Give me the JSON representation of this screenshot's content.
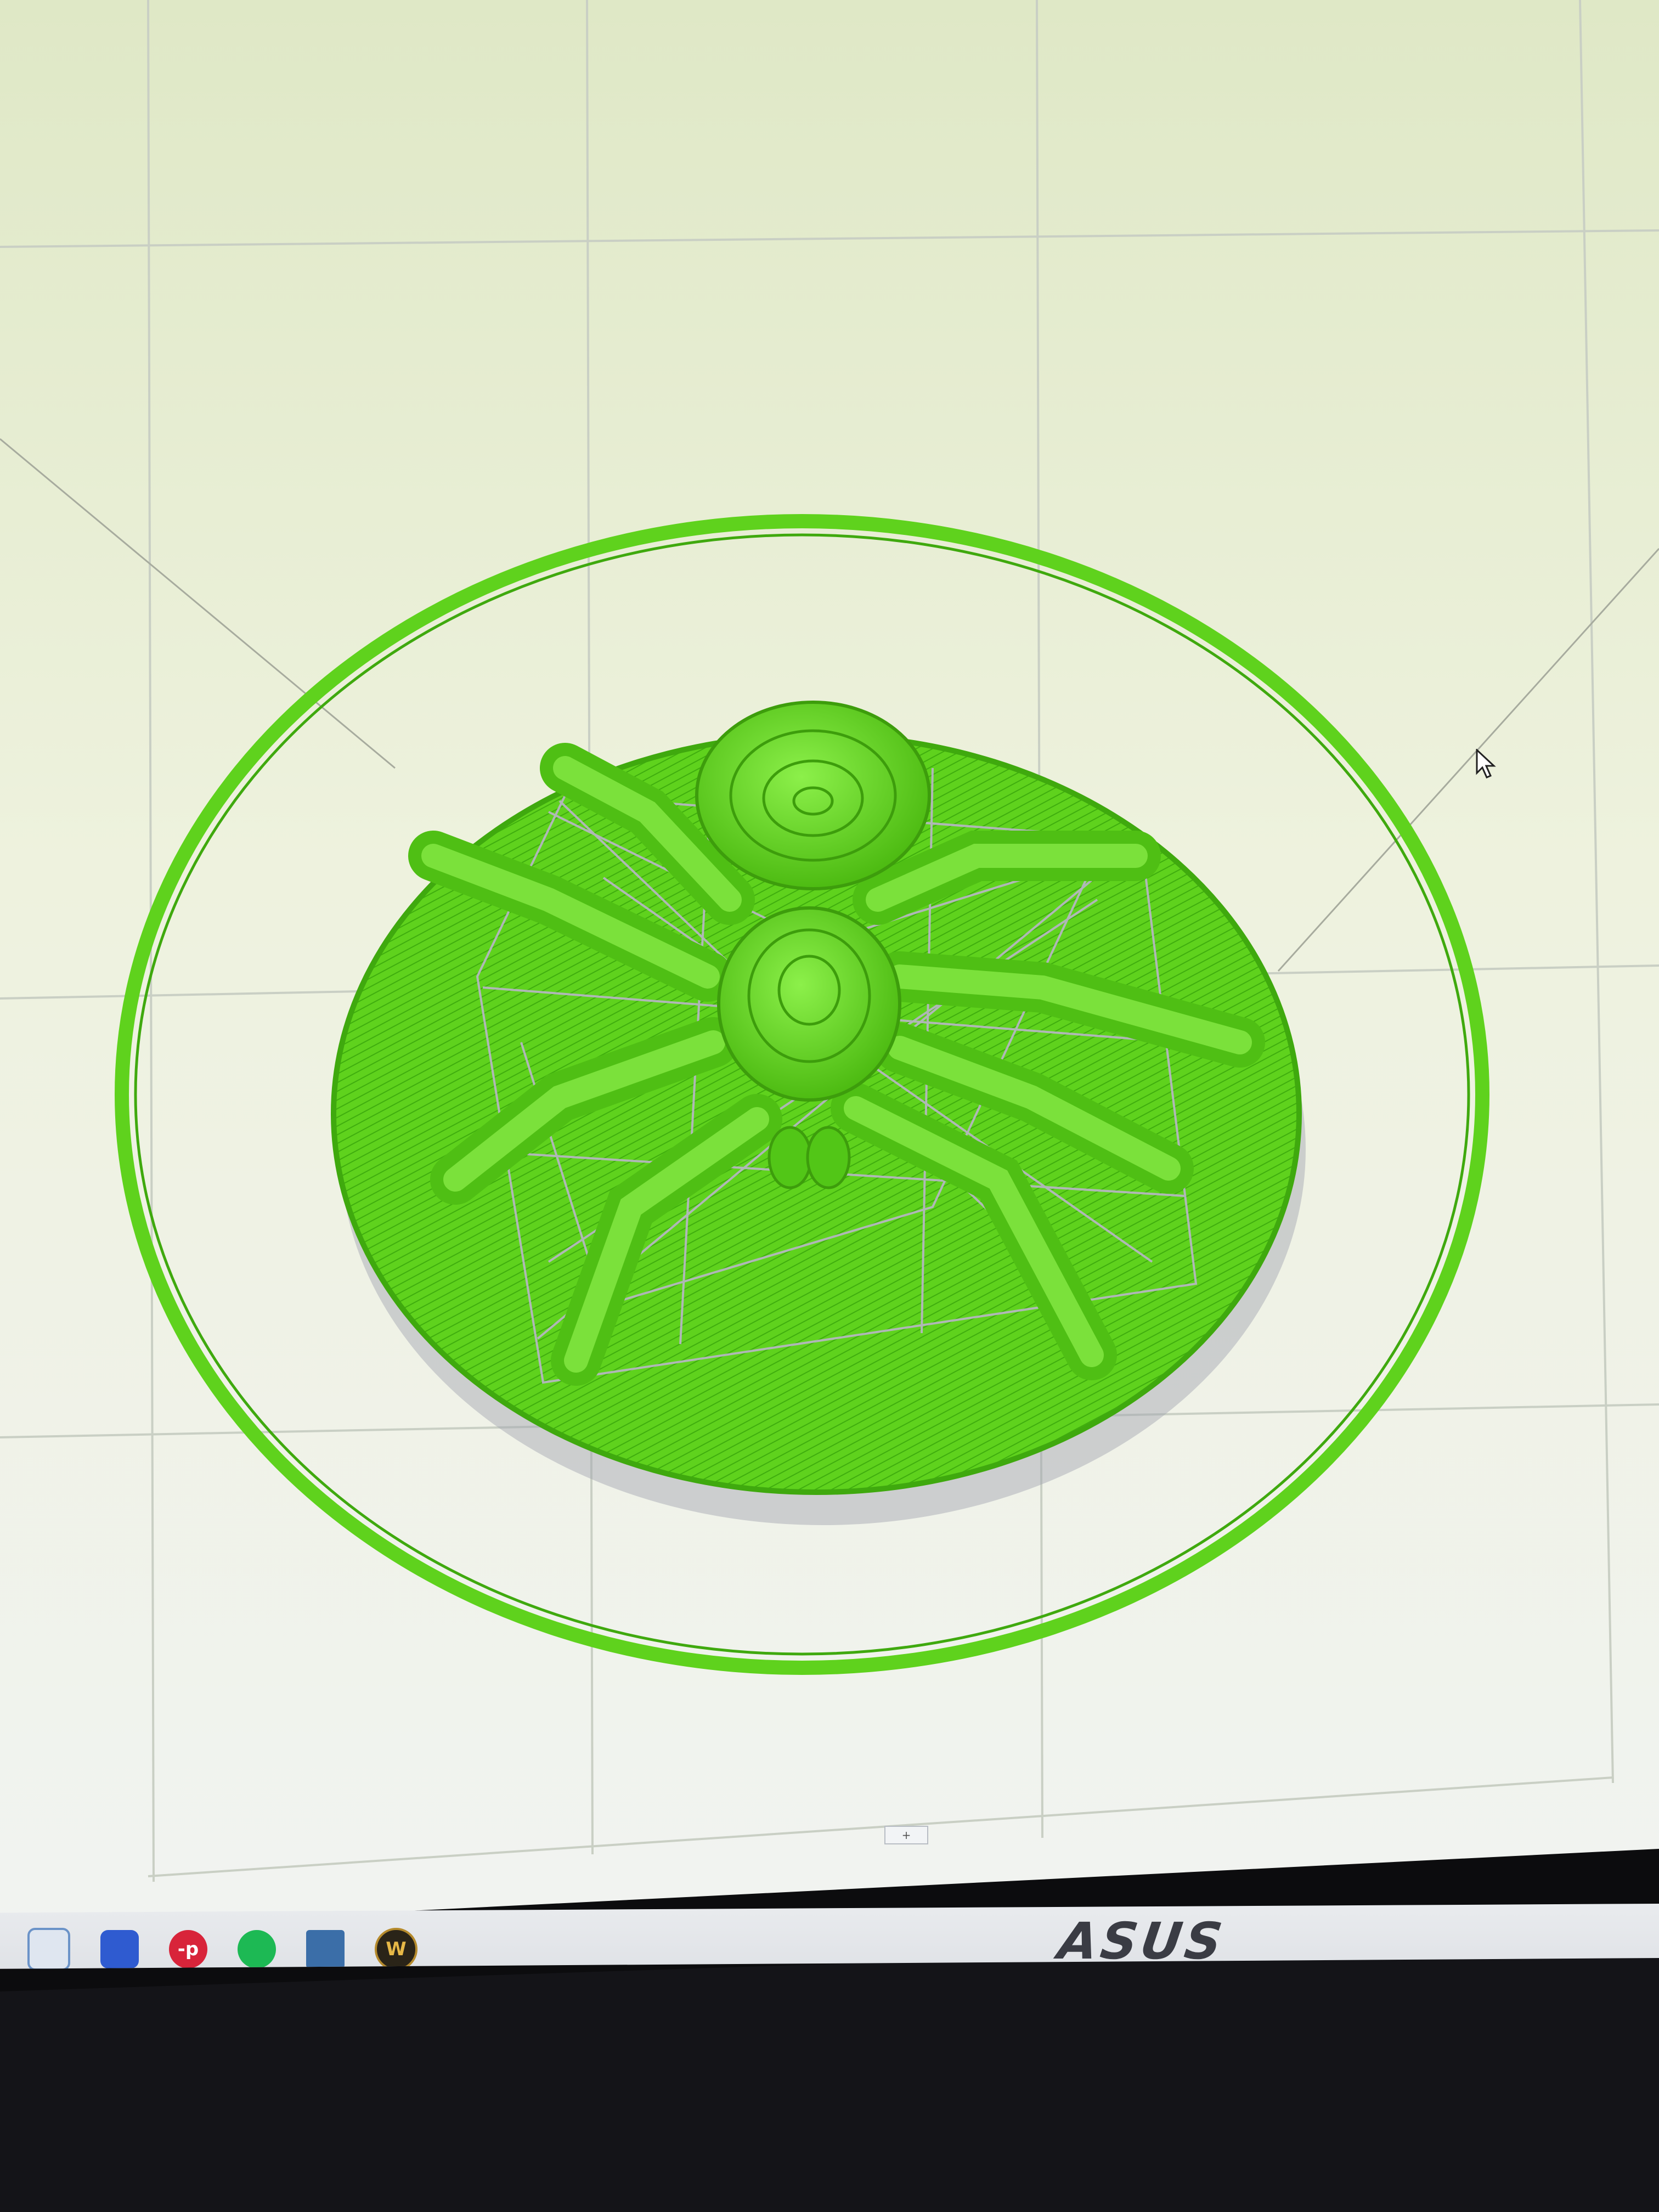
{
  "viewport": {
    "model": "spider-on-disc",
    "layer_color": "#66dd22",
    "travel_color": "#b9b6c8",
    "background_color": "#eef2de"
  },
  "scrollbar": {
    "thumb_glyph": "+"
  },
  "taskbar": {
    "icons": [
      {
        "name": "snipping-tool-icon",
        "glyph": ""
      },
      {
        "name": "network-drive-icon",
        "glyph": ""
      },
      {
        "name": "app-p-icon",
        "glyph": "-p"
      },
      {
        "name": "spotify-icon",
        "glyph": ""
      },
      {
        "name": "calculator-icon",
        "glyph": ""
      },
      {
        "name": "world-of-warcraft-icon",
        "glyph": "W"
      }
    ]
  },
  "monitor": {
    "brand": "ASUS"
  }
}
